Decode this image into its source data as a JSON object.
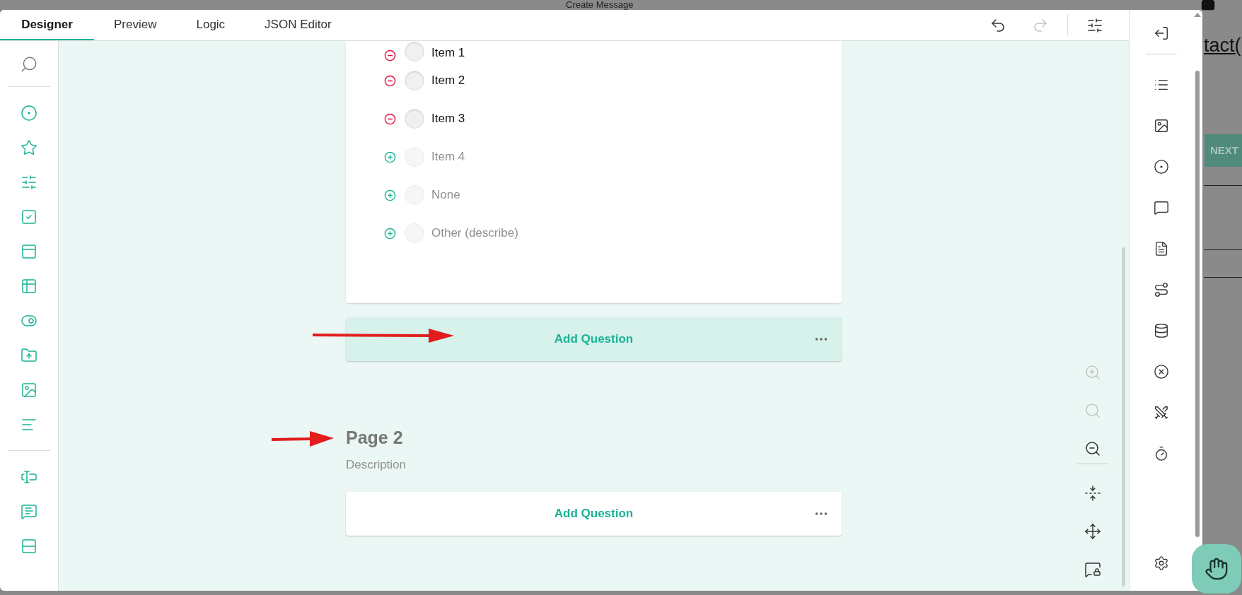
{
  "backdrop": {
    "title": "Create Message",
    "link_text": "tact(",
    "next_button": "NEXT"
  },
  "tabs": [
    {
      "label": "Designer",
      "selected": true
    },
    {
      "label": "Preview",
      "selected": false
    },
    {
      "label": "Logic",
      "selected": false
    },
    {
      "label": "JSON Editor",
      "selected": false
    }
  ],
  "toolbar": [
    {
      "kind": "undo",
      "disabled": false
    },
    {
      "kind": "redo",
      "disabled": true
    },
    {
      "kind": "settings",
      "disabled": false
    }
  ],
  "question": {
    "choices": [
      {
        "label": "Item 1",
        "kind": "choice",
        "checked": false
      },
      {
        "label": "Item 2",
        "kind": "choice",
        "checked": false
      },
      {
        "label": "Item 3",
        "kind": "choice",
        "checked": false
      },
      {
        "label": "Item 4",
        "kind": "suggested",
        "checked": false
      },
      {
        "label": "None",
        "kind": "suggested",
        "checked": false
      },
      {
        "label": "Other (describe)",
        "kind": "suggested",
        "checked": false
      }
    ]
  },
  "add_question_bars": [
    {
      "label": "Add Question",
      "selected": true
    },
    {
      "label": "Add Question",
      "selected": false
    }
  ],
  "page_2": {
    "title": "Page 2",
    "description": "Description"
  },
  "zoom_tools": [
    {
      "kind": "zoom-in",
      "disabled": true
    },
    {
      "kind": "zoom-reset",
      "disabled": true
    },
    {
      "kind": "zoom-out",
      "disabled": false
    },
    {
      "kind": "collapse",
      "disabled": false
    },
    {
      "kind": "expand",
      "disabled": false
    },
    {
      "kind": "lock",
      "disabled": false
    }
  ]
}
